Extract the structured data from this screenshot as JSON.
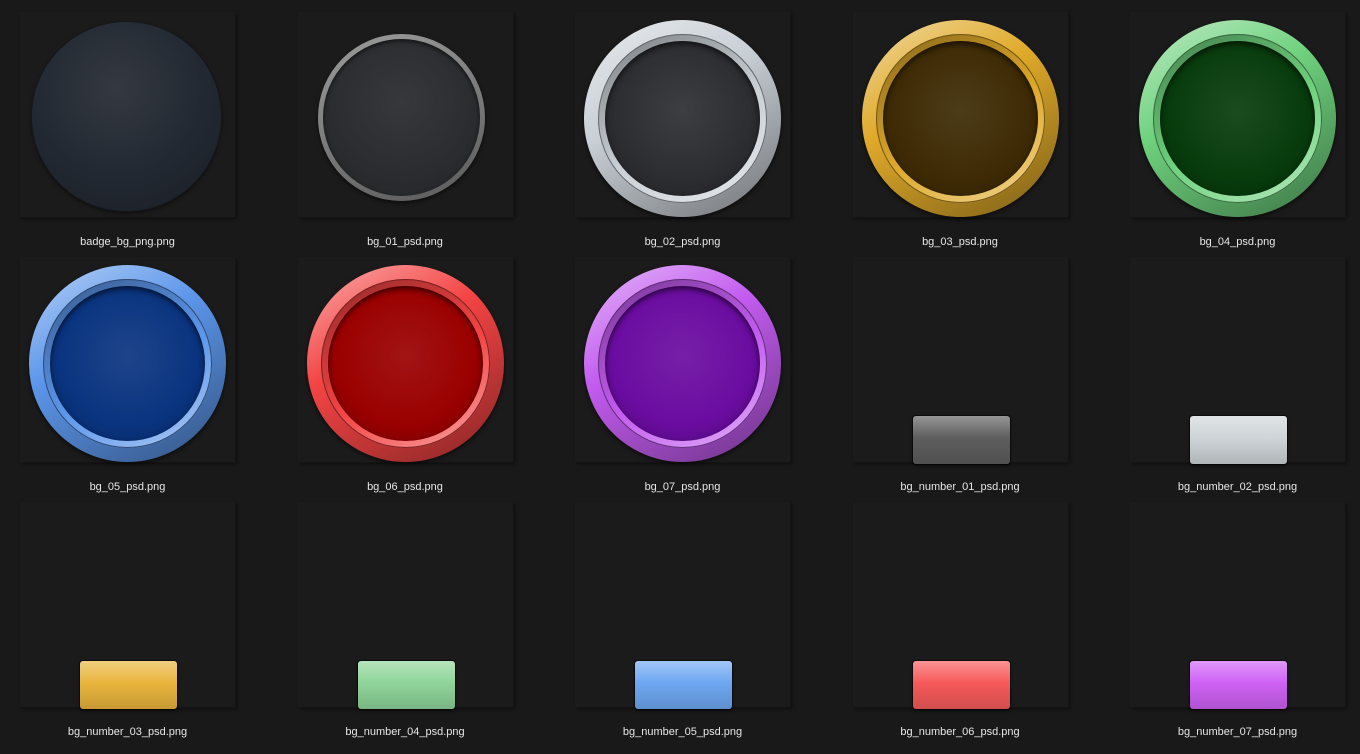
{
  "files": [
    {
      "name": "badge_bg_png.png",
      "kind": "disk",
      "color": "#222831"
    },
    {
      "name": "bg_01_psd.png",
      "kind": "ring-thin",
      "color": "#8a8a8a"
    },
    {
      "name": "bg_02_psd.png",
      "kind": "ring",
      "color": "#c9d0d6"
    },
    {
      "name": "bg_03_psd.png",
      "kind": "ring",
      "color": "#e0aa2a"
    },
    {
      "name": "bg_04_psd.png",
      "kind": "ring",
      "color": "#6fd27e"
    },
    {
      "name": "bg_05_psd.png",
      "kind": "ring",
      "color": "#5c96ea"
    },
    {
      "name": "bg_06_psd.png",
      "kind": "ring",
      "color": "#f44444"
    },
    {
      "name": "bg_07_psd.png",
      "kind": "ring",
      "color": "#c35cf0"
    },
    {
      "name": "bg_number_01_psd.png",
      "kind": "plate",
      "color": "#5e5e5e"
    },
    {
      "name": "bg_number_02_psd.png",
      "kind": "plate",
      "color": "#cfd5d8"
    },
    {
      "name": "bg_number_03_psd.png",
      "kind": "plate",
      "color": "#e9b53d"
    },
    {
      "name": "bg_number_04_psd.png",
      "kind": "plate",
      "color": "#8fd59a"
    },
    {
      "name": "bg_number_05_psd.png",
      "kind": "plate",
      "color": "#6ea8f2"
    },
    {
      "name": "bg_number_06_psd.png",
      "kind": "plate",
      "color": "#f75a5a"
    },
    {
      "name": "bg_number_07_psd.png",
      "kind": "plate",
      "color": "#cf62f5"
    }
  ],
  "ring_inner_colors": {
    "bg_01_psd.png": "#2b2d31",
    "bg_02_psd.png": "#2b2d31",
    "bg_03_psd.png": "#3e2b05",
    "bg_04_psd.png": "#073b0c",
    "bg_05_psd.png": "#0a3480",
    "bg_06_psd.png": "#9a0000",
    "bg_07_psd.png": "#6a0ca0"
  }
}
